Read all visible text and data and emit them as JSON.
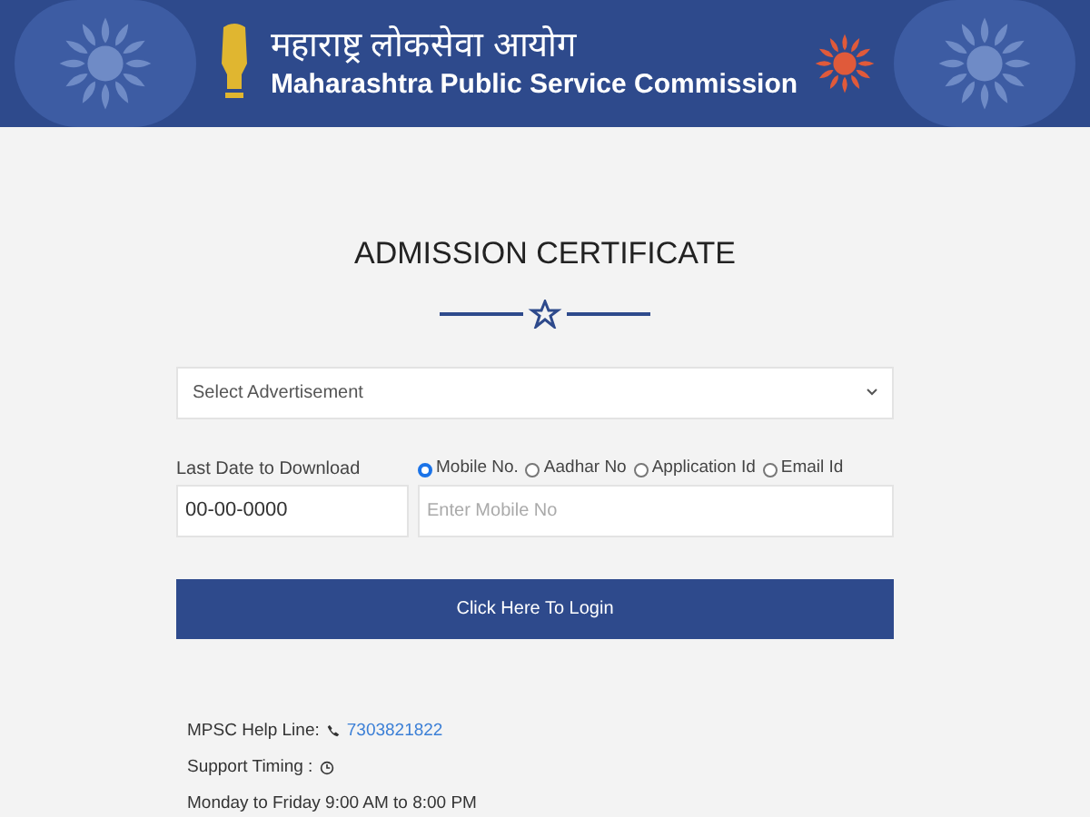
{
  "header": {
    "title_marathi": "महाराष्ट्र लोकसेवा आयोग",
    "title_english": "Maharashtra Public Service Commission"
  },
  "heading": "ADMISSION CERTIFICATE",
  "advertisement_select": {
    "value": "Select Advertisement"
  },
  "date_field": {
    "label": "Last Date to Download",
    "value": "00-00-0000"
  },
  "id_options": [
    {
      "label": "Mobile No.",
      "selected": true
    },
    {
      "label": "Aadhar No",
      "selected": false
    },
    {
      "label": "Application Id",
      "selected": false
    },
    {
      "label": "Email Id",
      "selected": false
    }
  ],
  "id_field": {
    "placeholder": "Enter Mobile No"
  },
  "login_button": "Click Here To Login",
  "help": {
    "label": "MPSC Help Line:",
    "phone": "7303821822",
    "timing_label": "Support Timing :",
    "timing": "Monday to Friday 9:00 AM to 8:00 PM"
  }
}
